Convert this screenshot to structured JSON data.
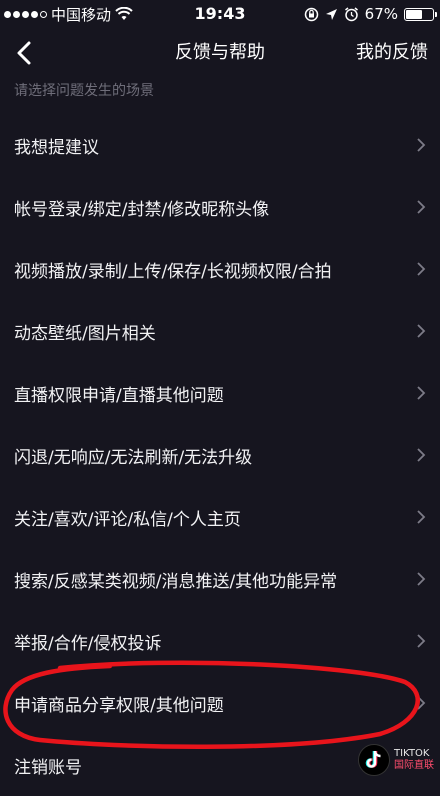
{
  "status_bar": {
    "carrier": "中国移动",
    "time": "19:43",
    "battery": "67%",
    "battery_level": 0.67
  },
  "header": {
    "title": "反馈与帮助",
    "right_link": "我的反馈"
  },
  "section_hint": "请选择问题发生的场景",
  "items": [
    {
      "label": "我想提建议"
    },
    {
      "label": "帐号登录/绑定/封禁/修改昵称头像"
    },
    {
      "label": "视频播放/录制/上传/保存/长视频权限/合拍"
    },
    {
      "label": "动态壁纸/图片相关"
    },
    {
      "label": "直播权限申请/直播其他问题"
    },
    {
      "label": "闪退/无响应/无法刷新/无法升级"
    },
    {
      "label": "关注/喜欢/评论/私信/个人主页"
    },
    {
      "label": "搜索/反感某类视频/消息推送/其他功能异常"
    },
    {
      "label": "举报/合作/侵权投诉"
    },
    {
      "label": "申请商品分享权限/其他问题"
    },
    {
      "label": "注销账号"
    }
  ],
  "watermark": {
    "line1": "TIKTOK",
    "line2": "国际直联"
  },
  "colors": {
    "background": "#16151f",
    "highlight_circle": "#e8141b"
  }
}
